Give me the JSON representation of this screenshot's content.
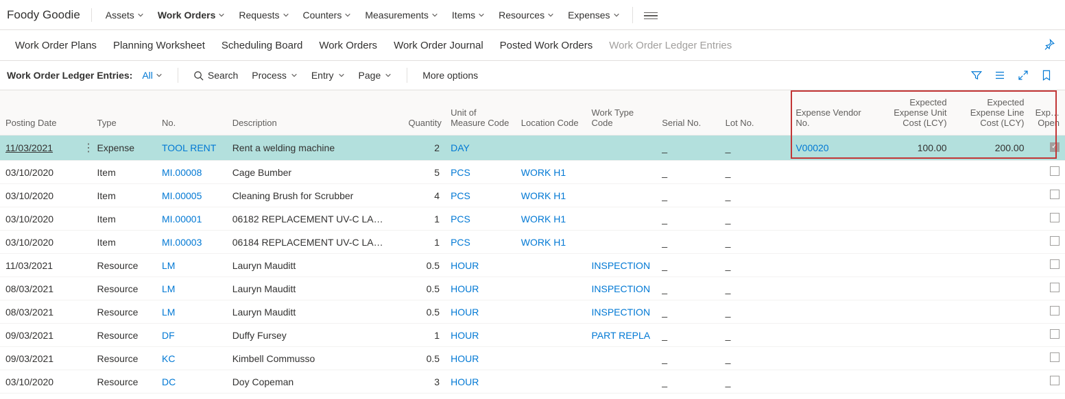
{
  "brand": "Foody Goodie",
  "top_nav": [
    {
      "label": "Assets"
    },
    {
      "label": "Work Orders",
      "active": true
    },
    {
      "label": "Requests"
    },
    {
      "label": "Counters"
    },
    {
      "label": "Measurements"
    },
    {
      "label": "Items"
    },
    {
      "label": "Resources"
    },
    {
      "label": "Expenses"
    }
  ],
  "sub_nav": [
    {
      "label": "Work Order Plans"
    },
    {
      "label": "Planning Worksheet"
    },
    {
      "label": "Scheduling Board"
    },
    {
      "label": "Work Orders"
    },
    {
      "label": "Work Order Journal"
    },
    {
      "label": "Posted Work Orders"
    },
    {
      "label": "Work Order Ledger Entries",
      "inactive": true
    }
  ],
  "action_bar": {
    "page_label": "Work Order Ledger Entries:",
    "filter": "All",
    "search": "Search",
    "process": "Process",
    "entry": "Entry",
    "page": "Page",
    "more": "More options"
  },
  "columns": {
    "posting_date": "Posting Date",
    "type": "Type",
    "no": "No.",
    "description": "Description",
    "quantity": "Quantity",
    "uom": "Unit of Measure Code",
    "location": "Location Code",
    "work_type": "Work Type Code",
    "serial": "Serial No.",
    "lot": "Lot No.",
    "vendor": "Expense Vendor No.",
    "exp_unit": "Expected Expense Unit Cost (LCY)",
    "exp_line": "Expected Expense Line Cost (LCY)",
    "open": "Exp… Open"
  },
  "rows": [
    {
      "selected": true,
      "posting_date": "11/03/2021",
      "type": "Expense",
      "no": "TOOL RENT",
      "description": "Rent a welding machine",
      "quantity": "2",
      "uom": "DAY",
      "location": "",
      "work_type": "",
      "serial": "_",
      "lot": "_",
      "vendor": "V00020",
      "exp_unit": "100.00",
      "exp_line": "200.00",
      "open": true
    },
    {
      "posting_date": "03/10/2020",
      "type": "Item",
      "no": "MI.00008",
      "description": "Cage Bumber",
      "quantity": "5",
      "uom": "PCS",
      "location": "WORK H1",
      "work_type": "",
      "serial": "_",
      "lot": "_",
      "vendor": "",
      "exp_unit": "",
      "exp_line": "",
      "open": false
    },
    {
      "posting_date": "03/10/2020",
      "type": "Item",
      "no": "MI.00005",
      "description": "Cleaning Brush for Scrubber",
      "quantity": "4",
      "uom": "PCS",
      "location": "WORK H1",
      "work_type": "",
      "serial": "_",
      "lot": "_",
      "vendor": "",
      "exp_unit": "",
      "exp_line": "",
      "open": false
    },
    {
      "posting_date": "03/10/2020",
      "type": "Item",
      "no": "MI.00001",
      "description": "06182 REPLACEMENT UV-C LA…",
      "quantity": "1",
      "uom": "PCS",
      "location": "WORK H1",
      "work_type": "",
      "serial": "_",
      "lot": "_",
      "vendor": "",
      "exp_unit": "",
      "exp_line": "",
      "open": false
    },
    {
      "posting_date": "03/10/2020",
      "type": "Item",
      "no": "MI.00003",
      "description": "06184 REPLACEMENT UV-C LA…",
      "quantity": "1",
      "uom": "PCS",
      "location": "WORK H1",
      "work_type": "",
      "serial": "_",
      "lot": "_",
      "vendor": "",
      "exp_unit": "",
      "exp_line": "",
      "open": false
    },
    {
      "posting_date": "11/03/2021",
      "type": "Resource",
      "no": "LM",
      "description": "Lauryn Mauditt",
      "quantity": "0.5",
      "uom": "HOUR",
      "location": "",
      "work_type": "INSPECTION",
      "serial": "_",
      "lot": "_",
      "vendor": "",
      "exp_unit": "",
      "exp_line": "",
      "open": false
    },
    {
      "posting_date": "08/03/2021",
      "type": "Resource",
      "no": "LM",
      "description": "Lauryn Mauditt",
      "quantity": "0.5",
      "uom": "HOUR",
      "location": "",
      "work_type": "INSPECTION",
      "serial": "_",
      "lot": "_",
      "vendor": "",
      "exp_unit": "",
      "exp_line": "",
      "open": false
    },
    {
      "posting_date": "08/03/2021",
      "type": "Resource",
      "no": "LM",
      "description": "Lauryn Mauditt",
      "quantity": "0.5",
      "uom": "HOUR",
      "location": "",
      "work_type": "INSPECTION",
      "serial": "_",
      "lot": "_",
      "vendor": "",
      "exp_unit": "",
      "exp_line": "",
      "open": false
    },
    {
      "posting_date": "09/03/2021",
      "type": "Resource",
      "no": "DF",
      "description": "Duffy Fursey",
      "quantity": "1",
      "uom": "HOUR",
      "location": "",
      "work_type": "PART REPLA",
      "serial": "_",
      "lot": "_",
      "vendor": "",
      "exp_unit": "",
      "exp_line": "",
      "open": false
    },
    {
      "posting_date": "09/03/2021",
      "type": "Resource",
      "no": "KC",
      "description": "Kimbell Commusso",
      "quantity": "0.5",
      "uom": "HOUR",
      "location": "",
      "work_type": "",
      "serial": "_",
      "lot": "_",
      "vendor": "",
      "exp_unit": "",
      "exp_line": "",
      "open": false
    },
    {
      "posting_date": "03/10/2020",
      "type": "Resource",
      "no": "DC",
      "description": "Doy Copeman",
      "quantity": "3",
      "uom": "HOUR",
      "location": "",
      "work_type": "",
      "serial": "_",
      "lot": "_",
      "vendor": "",
      "exp_unit": "",
      "exp_line": "",
      "open": false
    }
  ]
}
